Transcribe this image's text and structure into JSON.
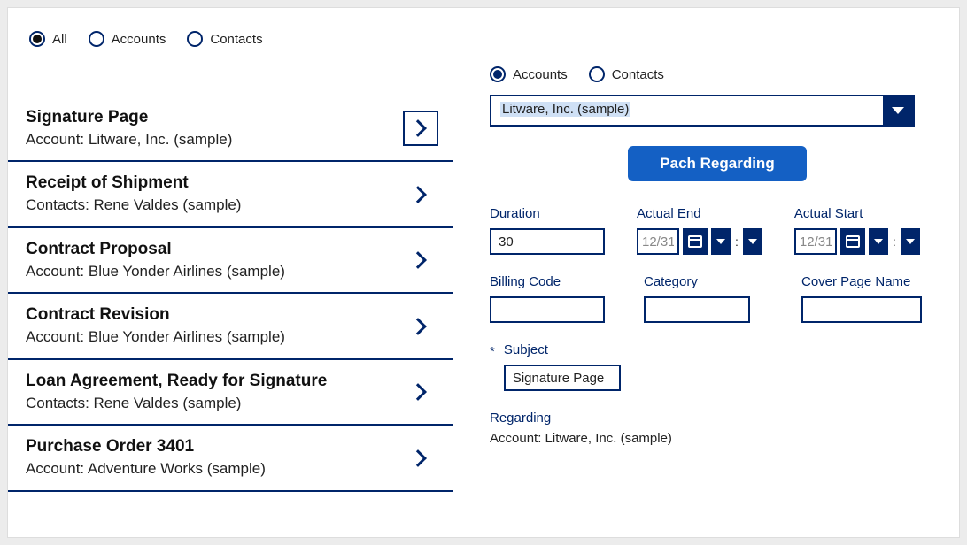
{
  "topFilters": {
    "all": "All",
    "accounts": "Accounts",
    "contacts": "Contacts"
  },
  "list": [
    {
      "title": "Signature Page",
      "subtitle": "Account: Litware, Inc. (sample)"
    },
    {
      "title": "Receipt of Shipment",
      "subtitle": "Contacts: Rene Valdes (sample)"
    },
    {
      "title": "Contract Proposal",
      "subtitle": "Account: Blue Yonder Airlines (sample)"
    },
    {
      "title": "Contract Revision",
      "subtitle": "Account: Blue Yonder Airlines (sample)"
    },
    {
      "title": "Loan Agreement, Ready for Signature",
      "subtitle": "Contacts: Rene Valdes (sample)"
    },
    {
      "title": "Purchase Order 3401",
      "subtitle": "Account: Adventure Works (sample)"
    }
  ],
  "detail": {
    "filters": {
      "accounts": "Accounts",
      "contacts": "Contacts"
    },
    "combo_value": "Litware, Inc. (sample)",
    "action_button": "Pach Regarding",
    "fields": {
      "duration": {
        "label": "Duration",
        "value": "30"
      },
      "actual_end": {
        "label": "Actual End",
        "date": "12/31"
      },
      "actual_start": {
        "label": "Actual Start",
        "date": "12/31"
      },
      "billing_code": {
        "label": "Billing Code",
        "value": ""
      },
      "category": {
        "label": "Category",
        "value": ""
      },
      "cover_page_name": {
        "label": "Cover Page Name",
        "value": ""
      },
      "subject": {
        "label": "Subject",
        "value": "Signature Page"
      },
      "regarding": {
        "label": "Regarding",
        "value": "Account: Litware, Inc. (sample)"
      }
    }
  }
}
